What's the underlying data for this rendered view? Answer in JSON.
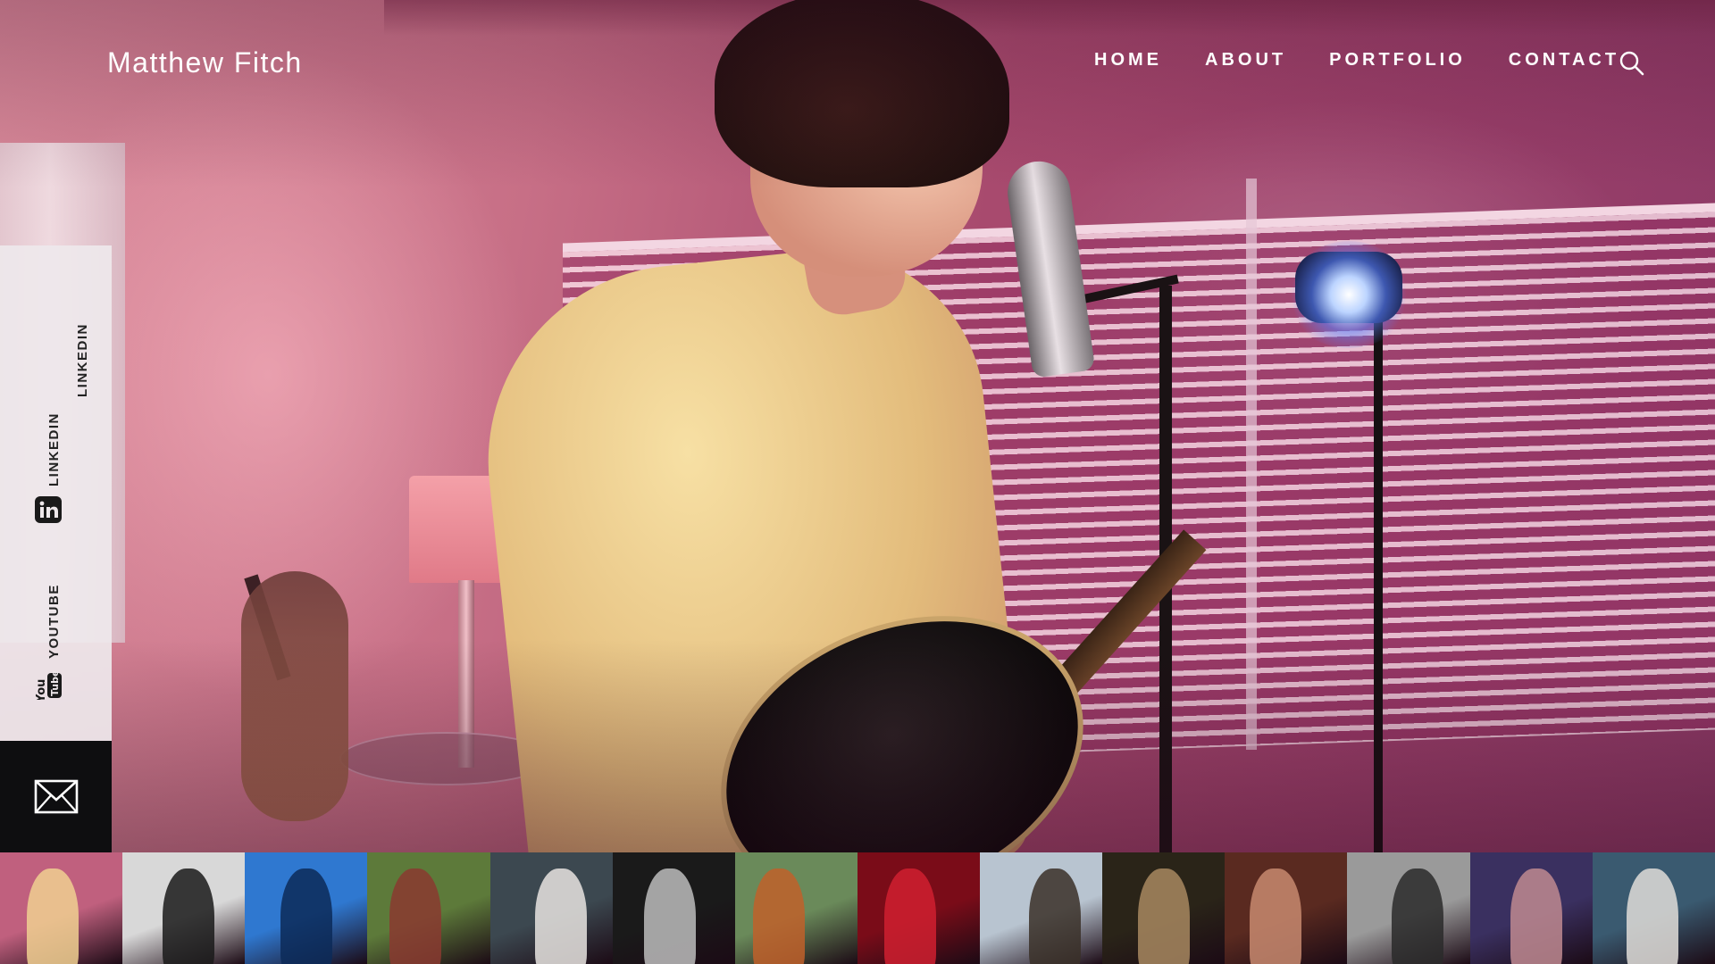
{
  "site": {
    "title": "Matthew Fitch"
  },
  "nav": {
    "items": [
      {
        "label": "HOME"
      },
      {
        "label": "ABOUT"
      },
      {
        "label": "PORTFOLIO"
      },
      {
        "label": "CONTACT"
      }
    ],
    "search_icon": "search-icon"
  },
  "social": {
    "links": [
      {
        "label": "LINKEDIN",
        "icon": "linkedin-icon"
      },
      {
        "label": "YOUTUBE",
        "icon": "youtube-icon",
        "icon_text_top": "You",
        "icon_text_bottom": "Tube"
      }
    ],
    "mail_icon": "envelope-icon"
  },
  "colors": {
    "text": "#ffffff",
    "social_panel": "#eee8eb",
    "mail_panel": "#0e0e10"
  },
  "thumbnails": [
    {
      "name": "singer-studio",
      "bg": "#c0607e",
      "fig": "#f0d090"
    },
    {
      "name": "window-silhouette",
      "bg": "#d8d8d8",
      "fig": "#1a1a1a"
    },
    {
      "name": "blue-sky-profile",
      "bg": "#2f78d0",
      "fig": "#0c2a58"
    },
    {
      "name": "two-people-park",
      "bg": "#5d7a3a",
      "fig": "#8a3a30"
    },
    {
      "name": "woman-scarf",
      "bg": "#3c4850",
      "fig": "#e8e4e0"
    },
    {
      "name": "man-bw-pointing",
      "bg": "#1a1a1a",
      "fig": "#bdbdbd"
    },
    {
      "name": "redhead-couple",
      "bg": "#6a8a5a",
      "fig": "#c0602a"
    },
    {
      "name": "red-night-street",
      "bg": "#7a0c18",
      "fig": "#d02030"
    },
    {
      "name": "hat-man-sky",
      "bg": "#b8c4d0",
      "fig": "#3a3028"
    },
    {
      "name": "man-lighter",
      "bg": "#2a2418",
      "fig": "#a88860"
    },
    {
      "name": "man-closeup",
      "bg": "#5a2a20",
      "fig": "#c88a70"
    },
    {
      "name": "couple-bw",
      "bg": "#9a9a9a",
      "fig": "#2a2a2a"
    },
    {
      "name": "smoker-purple",
      "bg": "#3a3060",
      "fig": "#c08a90"
    },
    {
      "name": "man-reading",
      "bg": "#3a5a70",
      "fig": "#e0ddd8"
    }
  ]
}
